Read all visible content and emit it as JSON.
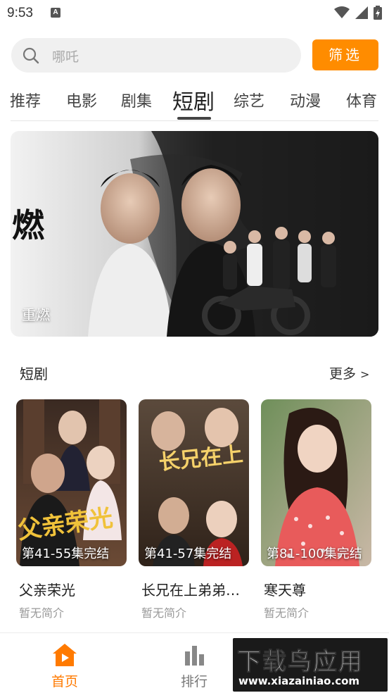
{
  "status_bar": {
    "time": "9:53",
    "notification_icon": "A"
  },
  "search": {
    "placeholder": "哪吒",
    "filter_label": "筛选"
  },
  "tabs": [
    {
      "label": "推荐"
    },
    {
      "label": "电影"
    },
    {
      "label": "剧集"
    },
    {
      "label": "短剧",
      "active": true
    },
    {
      "label": "综艺"
    },
    {
      "label": "动漫"
    },
    {
      "label": "体育"
    }
  ],
  "banner": {
    "caption": "重燃",
    "logo_text": "燃"
  },
  "section": {
    "title": "短剧",
    "more_label": "更多",
    "more_arrow": ">"
  },
  "cards": [
    {
      "badge": "第41-55集完结",
      "title": "父亲荣光",
      "desc": "暂无简介",
      "poster_text": "父亲荣光"
    },
    {
      "badge": "第41-57集完结",
      "title": "长兄在上弟弟妹妹知错了",
      "desc": "暂无简介",
      "poster_text": "长兄在上"
    },
    {
      "badge": "第81-100集完结",
      "title": "寒天尊",
      "desc": "暂无简介",
      "poster_text": ""
    }
  ],
  "bottom_nav": [
    {
      "label": "首页",
      "icon": "home-icon",
      "active": true
    },
    {
      "label": "排行",
      "icon": "bar-chart-icon",
      "active": false
    }
  ],
  "watermark": {
    "top": "下载鸟应用",
    "bottom": "www.xiazainiao.com"
  },
  "colors": {
    "accent": "#ff8c00",
    "nav_active": "#ff7a00"
  }
}
